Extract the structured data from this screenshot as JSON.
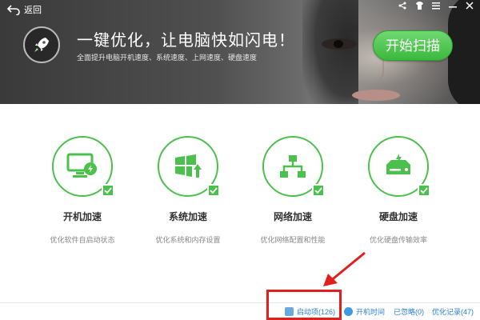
{
  "header": {
    "back_label": "返回",
    "headline": "一键优化，让电脑快如闪电！",
    "subline": "全面提升电脑开机速度、系统速度、上网速度、硬盘速度",
    "scan_button": "开始扫描"
  },
  "window_controls": [
    "share",
    "skin",
    "menu",
    "minimize",
    "close"
  ],
  "cards": [
    {
      "title": "开机加速",
      "desc": "优化软件自启动状态",
      "icon": "monitor-power-icon"
    },
    {
      "title": "系统加速",
      "desc": "优化系统和内存设置",
      "icon": "windows-upgrade-icon"
    },
    {
      "title": "网络加速",
      "desc": "优化网络配置和性能",
      "icon": "network-topology-icon"
    },
    {
      "title": "硬盘加速",
      "desc": "优化硬盘传输效率",
      "icon": "hard-disk-icon"
    }
  ],
  "statusbar": {
    "startup_items": "启动项(126)",
    "boot_time": "开机时间",
    "ignored": "已忽略(0)",
    "history": "优化记录(47)"
  },
  "colors": {
    "accent_green": "#4cc04c",
    "link_blue": "#2a82d6",
    "annotation_red": "#e0201c"
  }
}
